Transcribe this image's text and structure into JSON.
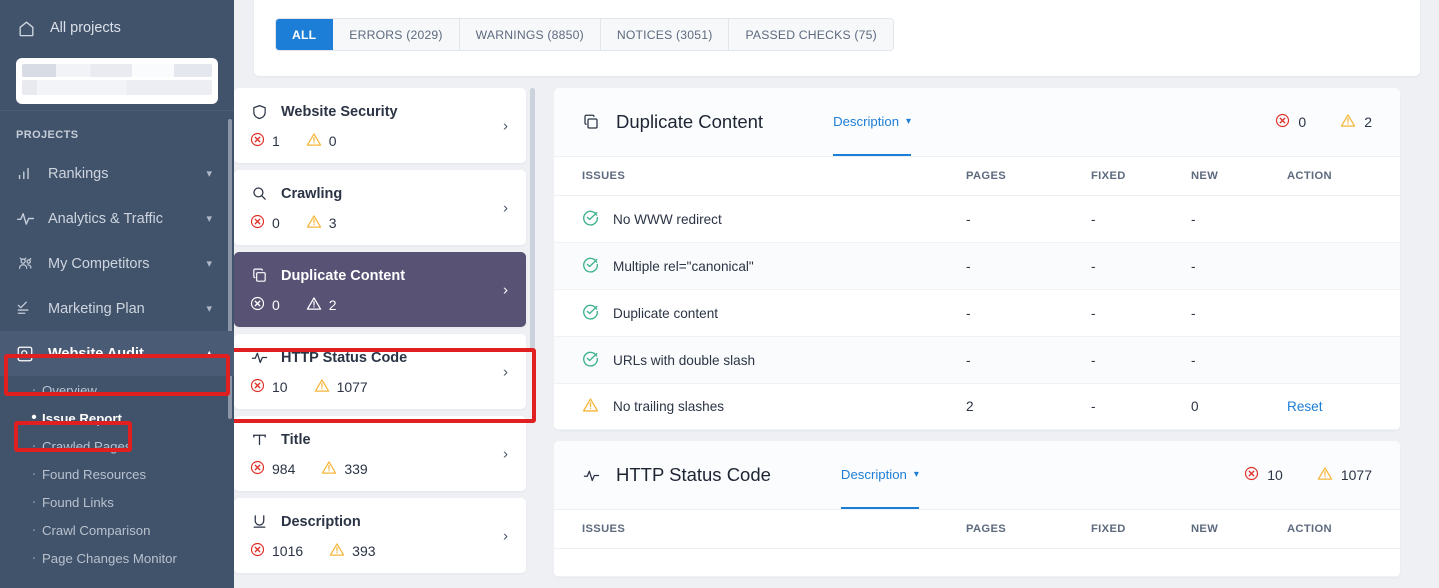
{
  "sidebar": {
    "all_projects": {
      "label": "All projects",
      "icon": "home-icon"
    },
    "project_selector": {
      "redacted": true
    },
    "section_label": "PROJECTS",
    "nav": [
      {
        "label": "Rankings",
        "icon": "bar-chart-icon",
        "chevron": "chevron-down-icon",
        "active": false
      },
      {
        "label": "Analytics & Traffic",
        "icon": "pulse-icon",
        "chevron": "chevron-down-icon",
        "active": false
      },
      {
        "label": "My Competitors",
        "icon": "people-icon",
        "chevron": "chevron-down-icon",
        "active": false
      },
      {
        "label": "Marketing Plan",
        "icon": "checklist-icon",
        "chevron": "chevron-down-icon",
        "active": false
      },
      {
        "label": "Website Audit",
        "icon": "magnifier-box-icon",
        "chevron": "chevron-up-icon",
        "active": true
      }
    ],
    "sub_items": [
      {
        "label": "Overview",
        "current": false
      },
      {
        "label": "Issue Report",
        "current": true
      },
      {
        "label": "Crawled Pages",
        "current": false
      },
      {
        "label": "Found Resources",
        "current": false
      },
      {
        "label": "Found Links",
        "current": false
      },
      {
        "label": "Crawl Comparison",
        "current": false
      },
      {
        "label": "Page Changes Monitor",
        "current": false
      }
    ]
  },
  "tabs": [
    {
      "label": "ALL",
      "active": true
    },
    {
      "label": "ERRORS (2029)",
      "active": false
    },
    {
      "label": "WARNINGS (8850)",
      "active": false
    },
    {
      "label": "NOTICES (3051)",
      "active": false
    },
    {
      "label": "PASSED CHECKS (75)",
      "active": false
    }
  ],
  "categories": [
    {
      "title": "Website Security",
      "icon": "shield-icon",
      "errors": "1",
      "warnings": "0",
      "selected": false
    },
    {
      "title": "Crawling",
      "icon": "magnifier-icon",
      "errors": "0",
      "warnings": "3",
      "selected": false
    },
    {
      "title": "Duplicate Content",
      "icon": "copy-icon",
      "errors": "0",
      "warnings": "2",
      "selected": true
    },
    {
      "title": "HTTP Status Code",
      "icon": "pulse-icon",
      "errors": "10",
      "warnings": "1077",
      "selected": false
    },
    {
      "title": "Title",
      "icon": "title-t-icon",
      "errors": "984",
      "warnings": "339",
      "selected": false
    },
    {
      "title": "Description",
      "icon": "underline-u-icon",
      "errors": "1016",
      "warnings": "393",
      "selected": false
    }
  ],
  "columns": [
    "ISSUES",
    "PAGES",
    "FIXED",
    "NEW",
    "ACTION"
  ],
  "panels": [
    {
      "title": "Duplicate Content",
      "icon": "copy-icon",
      "description_label": "Description",
      "description_chevron": "chevron-down-icon",
      "errors": "0",
      "warnings": "2",
      "rows": [
        {
          "status": "passed-check-icon",
          "issue": "No WWW redirect",
          "pages": "-",
          "fixed": "-",
          "new": "-",
          "action": ""
        },
        {
          "status": "passed-check-icon",
          "issue": "Multiple rel=\"canonical\"",
          "pages": "-",
          "fixed": "-",
          "new": "-",
          "action": ""
        },
        {
          "status": "passed-check-icon",
          "issue": "Duplicate content",
          "pages": "-",
          "fixed": "-",
          "new": "-",
          "action": ""
        },
        {
          "status": "passed-check-icon",
          "issue": "URLs with double slash",
          "pages": "-",
          "fixed": "-",
          "new": "-",
          "action": ""
        },
        {
          "status": "warning-icon",
          "issue": "No trailing slashes",
          "pages": "2",
          "fixed": "-",
          "new": "0",
          "action": "Reset"
        }
      ]
    },
    {
      "title": "HTTP Status Code",
      "icon": "pulse-icon",
      "description_label": "Description",
      "description_chevron": "chevron-down-icon",
      "errors": "10",
      "warnings": "1077",
      "rows": []
    }
  ],
  "colors": {
    "sidebar_bg": "#41526b",
    "accent_blue": "#1c7ed6",
    "error_red": "#e0322a",
    "warning_amber": "#f5b63c",
    "passed_green": "#3fb28f",
    "selected_card": "#585274",
    "annotation_red": "#e02020"
  }
}
